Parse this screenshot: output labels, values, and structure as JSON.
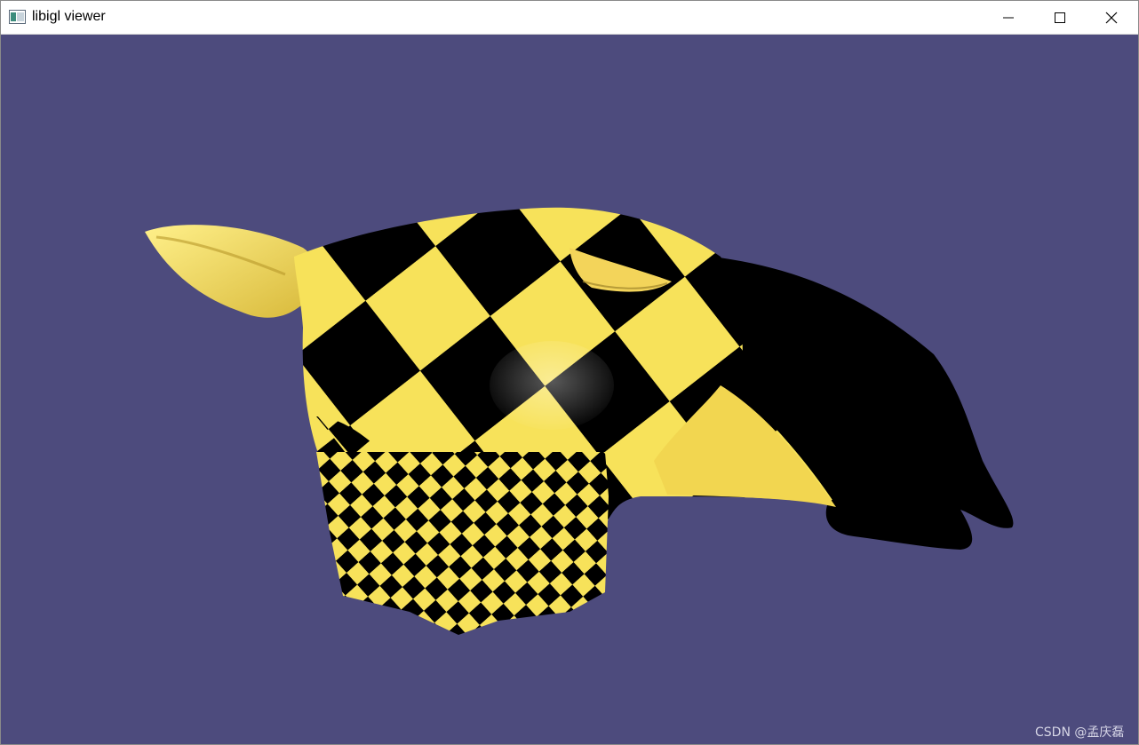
{
  "window": {
    "title": "libigl viewer",
    "controls": {
      "minimize": "minimize",
      "maximize": "maximize",
      "close": "close"
    }
  },
  "viewport": {
    "background_color": "#4d4b7d",
    "mesh_colors": {
      "light": "#f7e25a",
      "dark": "#000000"
    },
    "texture": "checkerboard",
    "watermark": "CSDN @孟庆磊"
  }
}
